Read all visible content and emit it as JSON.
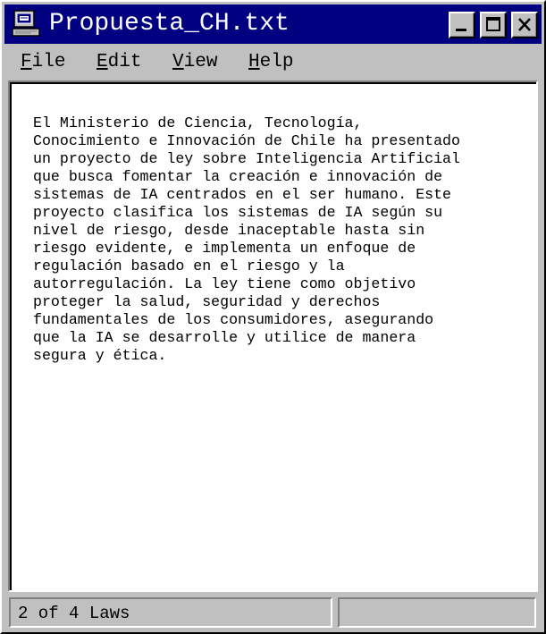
{
  "window": {
    "title": "Propuesta_CH.txt",
    "icon": "notepad-computer-icon",
    "controls": {
      "minimize_icon": "minimize-icon",
      "maximize_icon": "maximize-icon",
      "close_icon": "close-icon"
    }
  },
  "menu": {
    "file": {
      "accel": "F",
      "rest": "ile"
    },
    "edit": {
      "accel": "E",
      "rest": "dit"
    },
    "view": {
      "accel": "V",
      "rest": "iew"
    },
    "help": {
      "accel": "H",
      "rest": "elp"
    }
  },
  "document": {
    "lines": [
      "El Ministerio de Ciencia, Tecnología,",
      "Conocimiento e Innovación de Chile ha presentado",
      "un proyecto de ley sobre Inteligencia Artificial",
      "que busca fomentar la creación e innovación de",
      "sistemas de IA centrados en el ser humano. Este",
      "proyecto clasifica los sistemas de IA según su",
      "nivel de riesgo, desde inaceptable hasta sin",
      "riesgo evidente, e implementa un enfoque de",
      "regulación basado en el riesgo y la",
      "autorregulación. La ley tiene como objetivo",
      "proteger la salud, seguridad y derechos",
      "fundamentales de los consumidores, asegurando",
      "que la IA se desarrolle y utilice de manera",
      "segura y ética."
    ]
  },
  "status": {
    "left": "2 of 4 Laws",
    "right": ""
  },
  "colors": {
    "titlebar": "#000080",
    "face": "#c0c0c0",
    "text_bg": "#ffffff"
  }
}
